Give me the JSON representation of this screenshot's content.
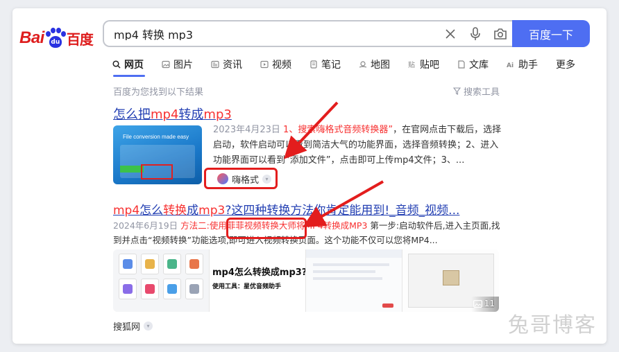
{
  "header": {
    "logo": {
      "bai": "Bai",
      "du": "du",
      "cn": "百度"
    },
    "search": {
      "value": "mp4 转换 mp3"
    },
    "tools": {
      "clear": "close-icon",
      "voice": "microphone-icon",
      "image": "camera-icon"
    },
    "search_button": "百度一下"
  },
  "tabs": [
    {
      "label": "网页",
      "icon": "search-icon"
    },
    {
      "label": "图片",
      "icon": "image-icon"
    },
    {
      "label": "资讯",
      "icon": "news-icon"
    },
    {
      "label": "视频",
      "icon": "video-icon"
    },
    {
      "label": "笔记",
      "icon": "note-icon"
    },
    {
      "label": "地图",
      "icon": "map-icon"
    },
    {
      "label": "贴吧",
      "icon": "tieba-icon"
    },
    {
      "label": "文库",
      "icon": "wenku-icon"
    },
    {
      "label": "助手",
      "icon": "ai-icon"
    },
    {
      "label": "更多",
      "icon": ""
    }
  ],
  "result_count": "百度为您找到以下结果",
  "search_tools": "搜索工具",
  "result1": {
    "title_pre": "怎么把",
    "title_hl1": "mp4",
    "title_mid": "转成",
    "title_hl2": "mp3",
    "thumb_text": "File conversion made easy",
    "date": "2023年4月23日",
    "snippet_hl": "1、搜索嗨格式音频转换器”",
    "snippet": "，在官网点击下载后，选择启动，软件启动可以看到简洁大气的功能界面，选择音频转换；2、进入功能界面可以看到”添加文件”，点击即可上传mp4文件；3、...",
    "source": "嗨格式"
  },
  "result2": {
    "title_hl1": "mp4",
    "title_t1": "怎么",
    "title_hl2": "转换",
    "title_t2": "成",
    "title_hl3": "mp3",
    "title_rest": "?这四种转换方法你肯定能用到!_音频_视频...",
    "date": "2024年6月19日",
    "snippet_hl": "方法二:使用菲菲视频转换大师将MP4转换成MP3",
    "snippet": " 第一步:启动软件后,进入主页面,找到并点击“视频转换”功能选项,即可进入视频转换页面。这个功能不仅可以您将MP4...",
    "img2_big": "mp4怎么转换成mp3?",
    "img2_small": "使用工具：星优音频助手",
    "image_count": "11",
    "source": "搜狐网"
  },
  "watermark": "兔哥博客",
  "colors": {
    "brand_blue": "#4e6ef2",
    "link": "#2440b3",
    "highlight": "#f73131",
    "annotation_red": "#e31d1d"
  }
}
